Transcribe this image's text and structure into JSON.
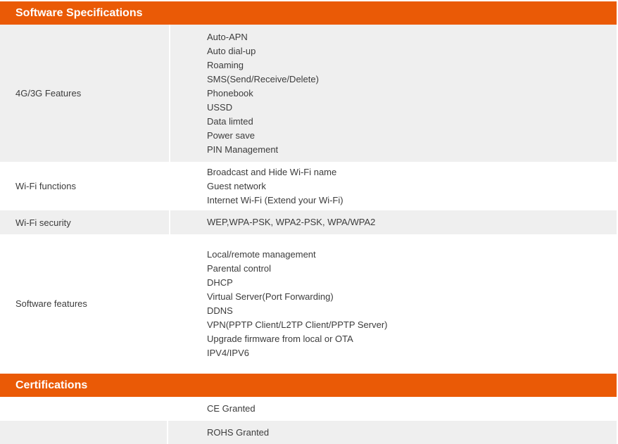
{
  "software": {
    "header": "Software Specifications",
    "rows": [
      {
        "label": "4G/3G Features",
        "items": [
          "Auto-APN",
          "Auto dial-up",
          "Roaming",
          "SMS(Send/Receive/Delete)",
          "Phonebook",
          "USSD",
          "Data limted",
          "Power save",
          "PIN Management"
        ]
      },
      {
        "label": "Wi-Fi functions",
        "items": [
          "Broadcast and Hide Wi-Fi name",
          "Guest network",
          "Internet Wi-Fi (Extend your Wi-Fi)"
        ]
      },
      {
        "label": "Wi-Fi security",
        "items": [
          "WEP,WPA-PSK, WPA2-PSK, WPA/WPA2"
        ]
      },
      {
        "label": "Software features",
        "items": [
          "Local/remote management",
          "Parental control",
          "DHCP",
          "Virtual Server(Port Forwarding)",
          "DDNS",
          "VPN(PPTP Client/L2TP Client/PPTP Server)",
          "Upgrade firmware from local or OTA",
          "IPV4/IPV6"
        ]
      }
    ]
  },
  "certifications": {
    "header": "Certifications",
    "rows": [
      {
        "label": "",
        "items": [
          "CE Granted"
        ]
      },
      {
        "label": "",
        "items": [
          "ROHS Granted"
        ]
      }
    ]
  }
}
